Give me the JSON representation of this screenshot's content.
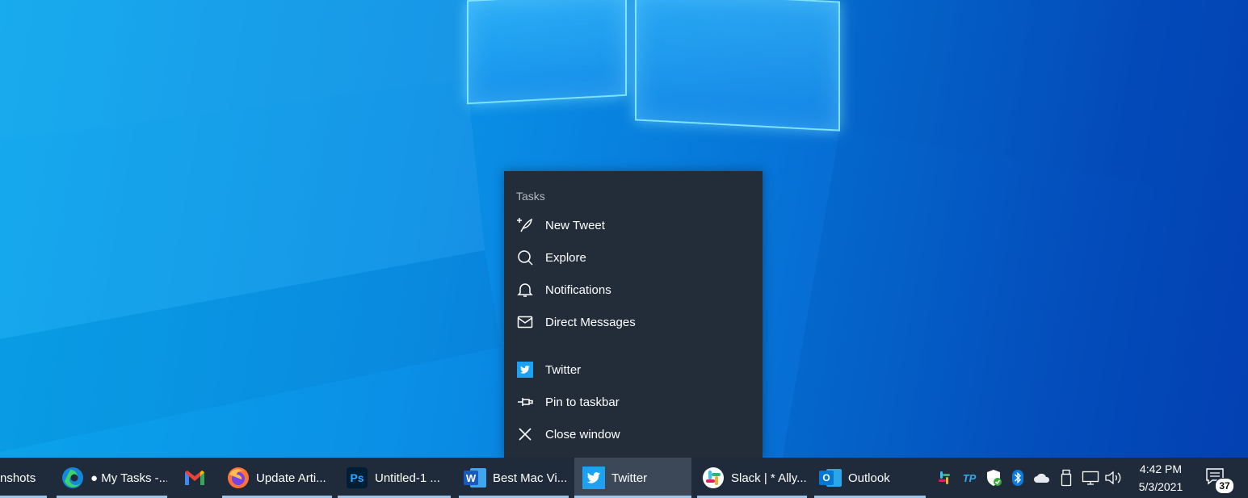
{
  "jumplist": {
    "header": "Tasks",
    "tasks": [
      {
        "label": "New Tweet",
        "icon": "quill-plus-icon"
      },
      {
        "label": "Explore",
        "icon": "search-icon"
      },
      {
        "label": "Notifications",
        "icon": "bell-icon"
      },
      {
        "label": "Direct Messages",
        "icon": "envelope-icon"
      }
    ],
    "app_actions": [
      {
        "label": "Twitter",
        "icon": "twitter-logo-icon"
      },
      {
        "label": "Pin to taskbar",
        "icon": "pin-icon"
      },
      {
        "label": "Close window",
        "icon": "close-icon"
      }
    ]
  },
  "taskbar": {
    "buttons": [
      {
        "label": "nshots",
        "icon": "folder-icon"
      },
      {
        "label": "● My Tasks -...",
        "icon": "edge-icon"
      },
      {
        "label": "",
        "icon": "gmail-icon"
      },
      {
        "label": "Update Arti...",
        "icon": "firefox-icon"
      },
      {
        "label": "Untitled-1 ...",
        "icon": "photoshop-icon"
      },
      {
        "label": "Best Mac Vi...",
        "icon": "word-icon"
      },
      {
        "label": "Twitter",
        "icon": "twitter-icon",
        "active": true
      },
      {
        "label": "Slack | * Ally...",
        "icon": "slack-icon"
      },
      {
        "label": "Outlook",
        "icon": "outlook-icon"
      }
    ],
    "photoshop_glyph": "Ps",
    "word_glyph": "W",
    "outlook_glyph": "O",
    "tray": {
      "tp_label": "TP",
      "time": "4:42 PM",
      "date": "5/3/2021",
      "notification_count": "37"
    }
  },
  "colors": {
    "menu_bg": "#232d3a",
    "taskbar_bg": "#1f2b3a",
    "active_button": "#3c4858",
    "twitter_blue": "#1da1f2"
  }
}
